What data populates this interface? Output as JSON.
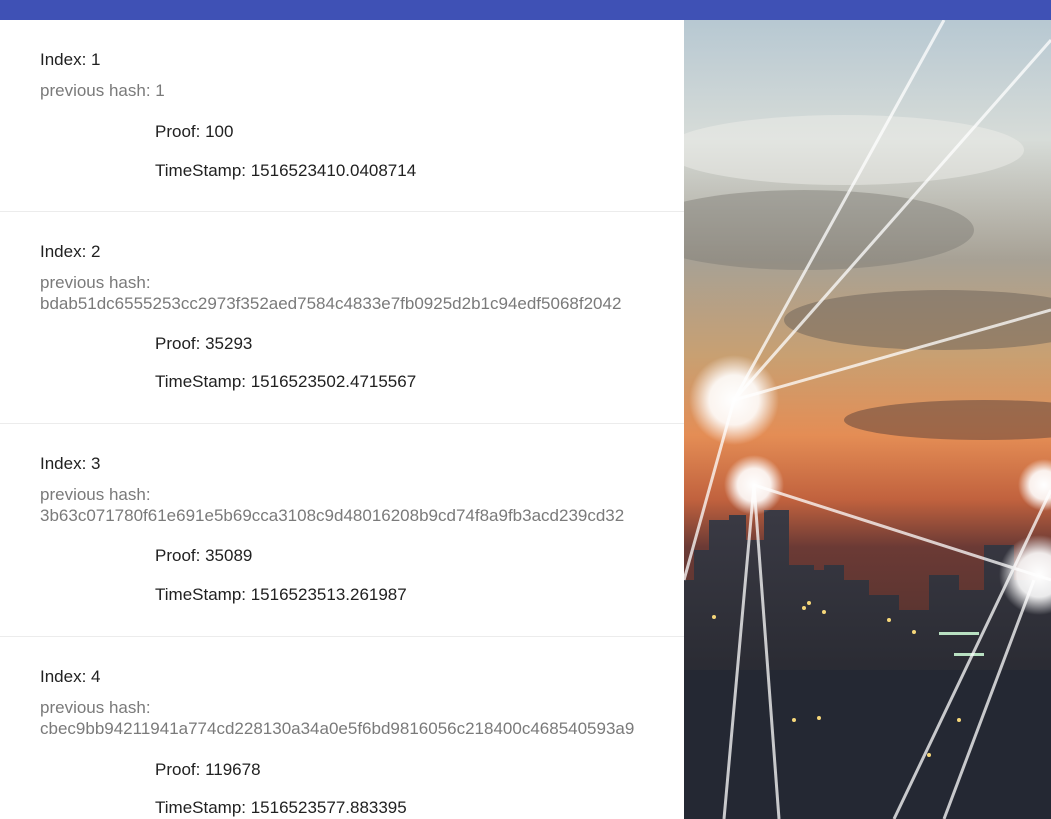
{
  "labels": {
    "index": "Index:",
    "previous_hash": "previous hash:",
    "proof": "Proof:",
    "timestamp": "TimeStamp:"
  },
  "blocks": [
    {
      "index": "Index: 1",
      "previous_hash": "previous hash: 1",
      "proof": "Proof: 100",
      "timestamp": "TimeStamp: 1516523410.0408714"
    },
    {
      "index": "Index: 2",
      "previous_hash_label": "previous hash:",
      "previous_hash": "bdab51dc6555253cc2973f352aed7584c4833e7fb0925d2b1c94edf5068f2042",
      "proof": "Proof: 35293",
      "timestamp": "TimeStamp: 1516523502.4715567"
    },
    {
      "index": "Index: 3",
      "previous_hash_label": "previous hash:",
      "previous_hash": "3b63c071780f61e691e5b69cca3108c9d48016208b9cd74f8a9fb3acd239cd32",
      "proof": "Proof: 35089",
      "timestamp": "TimeStamp: 1516523513.261987"
    },
    {
      "index": "Index: 4",
      "previous_hash_label": "previous hash:",
      "previous_hash": "cbec9bb94211941a774cd228130a34a0e5f6bd9816056c218400c468540593a9",
      "proof": "Proof: 119678",
      "timestamp": "TimeStamp: 1516523577.883395"
    }
  ],
  "colors": {
    "app_bar": "#3f51b5",
    "primary_text": "#212121",
    "secondary_text": "#7a7a7a"
  },
  "background_image": "city-network-sunset-image"
}
